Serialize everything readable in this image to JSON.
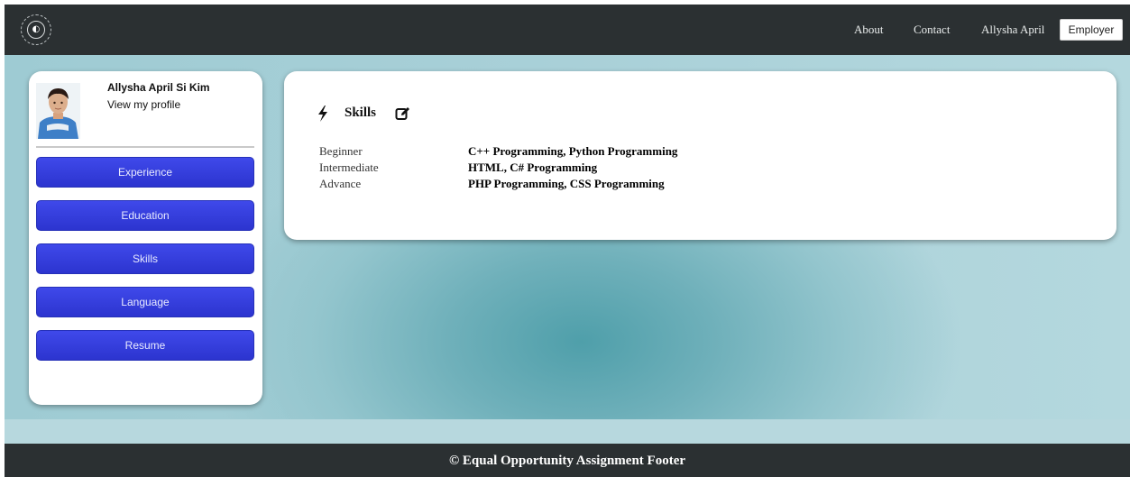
{
  "navbar": {
    "logo_icon": "equal-opportunity-logo-icon",
    "links": {
      "about": "About",
      "contact": "Contact",
      "user": "Allysha April"
    },
    "employer_button": "Employer"
  },
  "sidebar": {
    "profile": {
      "name": "Allysha April Si Kim",
      "link": "View my profile"
    },
    "buttons": {
      "experience": "Experience",
      "education": "Education",
      "skills": "Skills",
      "language": "Language",
      "resume": "Resume"
    }
  },
  "skills": {
    "title": "Skills",
    "icon": "bolt-icon",
    "edit_icon": "edit-icon",
    "rows": [
      {
        "level": "Beginner",
        "items": "C++ Programming, Python Programming"
      },
      {
        "level": "Intermediate",
        "items": "HTML, C# Programming"
      },
      {
        "level": "Advance",
        "items": "PHP Programming, CSS Programming"
      }
    ]
  },
  "footer": {
    "text": "© Equal Opportunity Assignment Footer"
  },
  "colors": {
    "navbar": "#2b3032",
    "sidebar_button": "#3039d8",
    "background_teal": "#6fb0ba"
  }
}
